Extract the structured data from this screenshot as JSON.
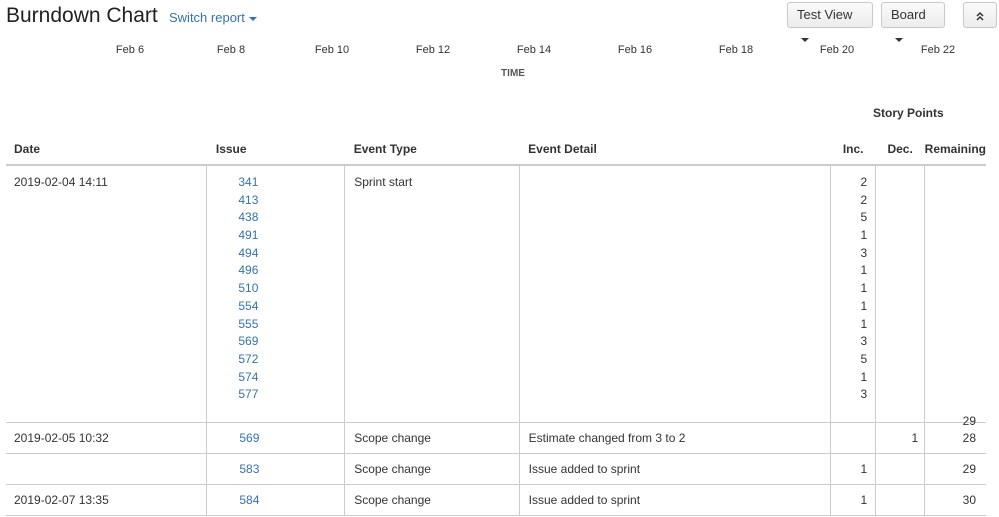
{
  "header": {
    "title": "Burndown Chart",
    "switch_report": "Switch report",
    "test_view": "Test View",
    "board": "Board"
  },
  "axis": {
    "ticks": [
      "Feb 6",
      "Feb 8",
      "Feb 10",
      "Feb 12",
      "Feb 14",
      "Feb 16",
      "Feb 18",
      "Feb 20",
      "Feb 22"
    ],
    "title": "TIME"
  },
  "table": {
    "group_header": "Story Points",
    "columns": {
      "date": "Date",
      "issue": "Issue",
      "event_type": "Event Type",
      "event_detail": "Event Detail",
      "inc": "Inc.",
      "dec": "Dec.",
      "remaining": "Remaining"
    },
    "sprint_start": {
      "date": "2019-02-04 14:11",
      "event_type": "Sprint start",
      "issues": [
        "341",
        "413",
        "438",
        "491",
        "494",
        "496",
        "510",
        "554",
        "555",
        "569",
        "572",
        "574",
        "577"
      ],
      "incs": [
        "2",
        "2",
        "5",
        "1",
        "3",
        "1",
        "1",
        "1",
        "1",
        "3",
        "5",
        "1",
        "3"
      ],
      "remaining": "29"
    },
    "rows": [
      {
        "date": "2019-02-05 10:32",
        "issue": "569",
        "event_type": "Scope change",
        "event_detail": "Estimate changed from 3 to 2",
        "inc": "",
        "dec": "1",
        "remaining": "28"
      },
      {
        "date": "",
        "issue": "583",
        "event_type": "Scope change",
        "event_detail": "Issue added to sprint",
        "inc": "1",
        "dec": "",
        "remaining": "29"
      },
      {
        "date": "2019-02-07 13:35",
        "issue": "584",
        "event_type": "Scope change",
        "event_detail": "Issue added to sprint",
        "inc": "1",
        "dec": "",
        "remaining": "30"
      }
    ]
  }
}
